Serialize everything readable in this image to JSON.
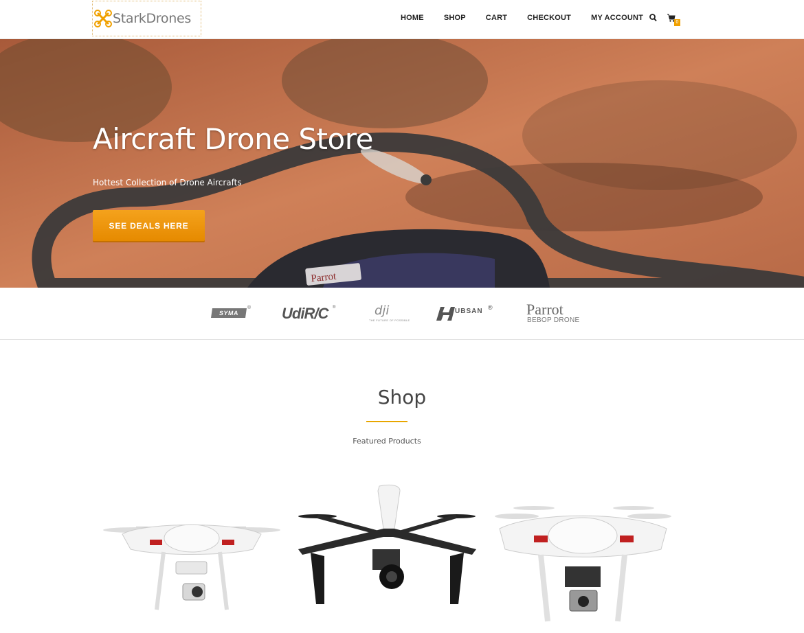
{
  "header": {
    "logo_text": "StarkDrones",
    "nav": [
      {
        "label": "HOME"
      },
      {
        "label": "SHOP"
      },
      {
        "label": "CART"
      },
      {
        "label": "CHECKOUT"
      },
      {
        "label": "MY ACCOUNT"
      }
    ],
    "cart_count": "0",
    "icons": [
      "search-icon",
      "cart-icon"
    ],
    "accent_color": "#f0a000"
  },
  "hero": {
    "title": "Aircraft Drone Store",
    "subtitle": "Hottest Collection of Drone Aircrafts",
    "cta_label": "SEE DEALS HERE",
    "cta_color": "#f39c12",
    "drone_label": "Parrot"
  },
  "brands": {
    "syma": "SYMA",
    "udirc": "UdiR/C",
    "dji": "dji",
    "dji_tagline": "THE FUTURE OF POSSIBLE",
    "hubsan": "UBSAN",
    "parrot": "Parrot",
    "parrot_sub": "BEBOP DRONE"
  },
  "shop": {
    "title": "Shop",
    "subtitle": "Featured Products",
    "underline_color": "#e8a600",
    "products": [
      {
        "image": "white-quadcopter-drone"
      },
      {
        "image": "black-inspire-drone"
      },
      {
        "image": "white-phantom-drone-with-camera"
      }
    ]
  }
}
